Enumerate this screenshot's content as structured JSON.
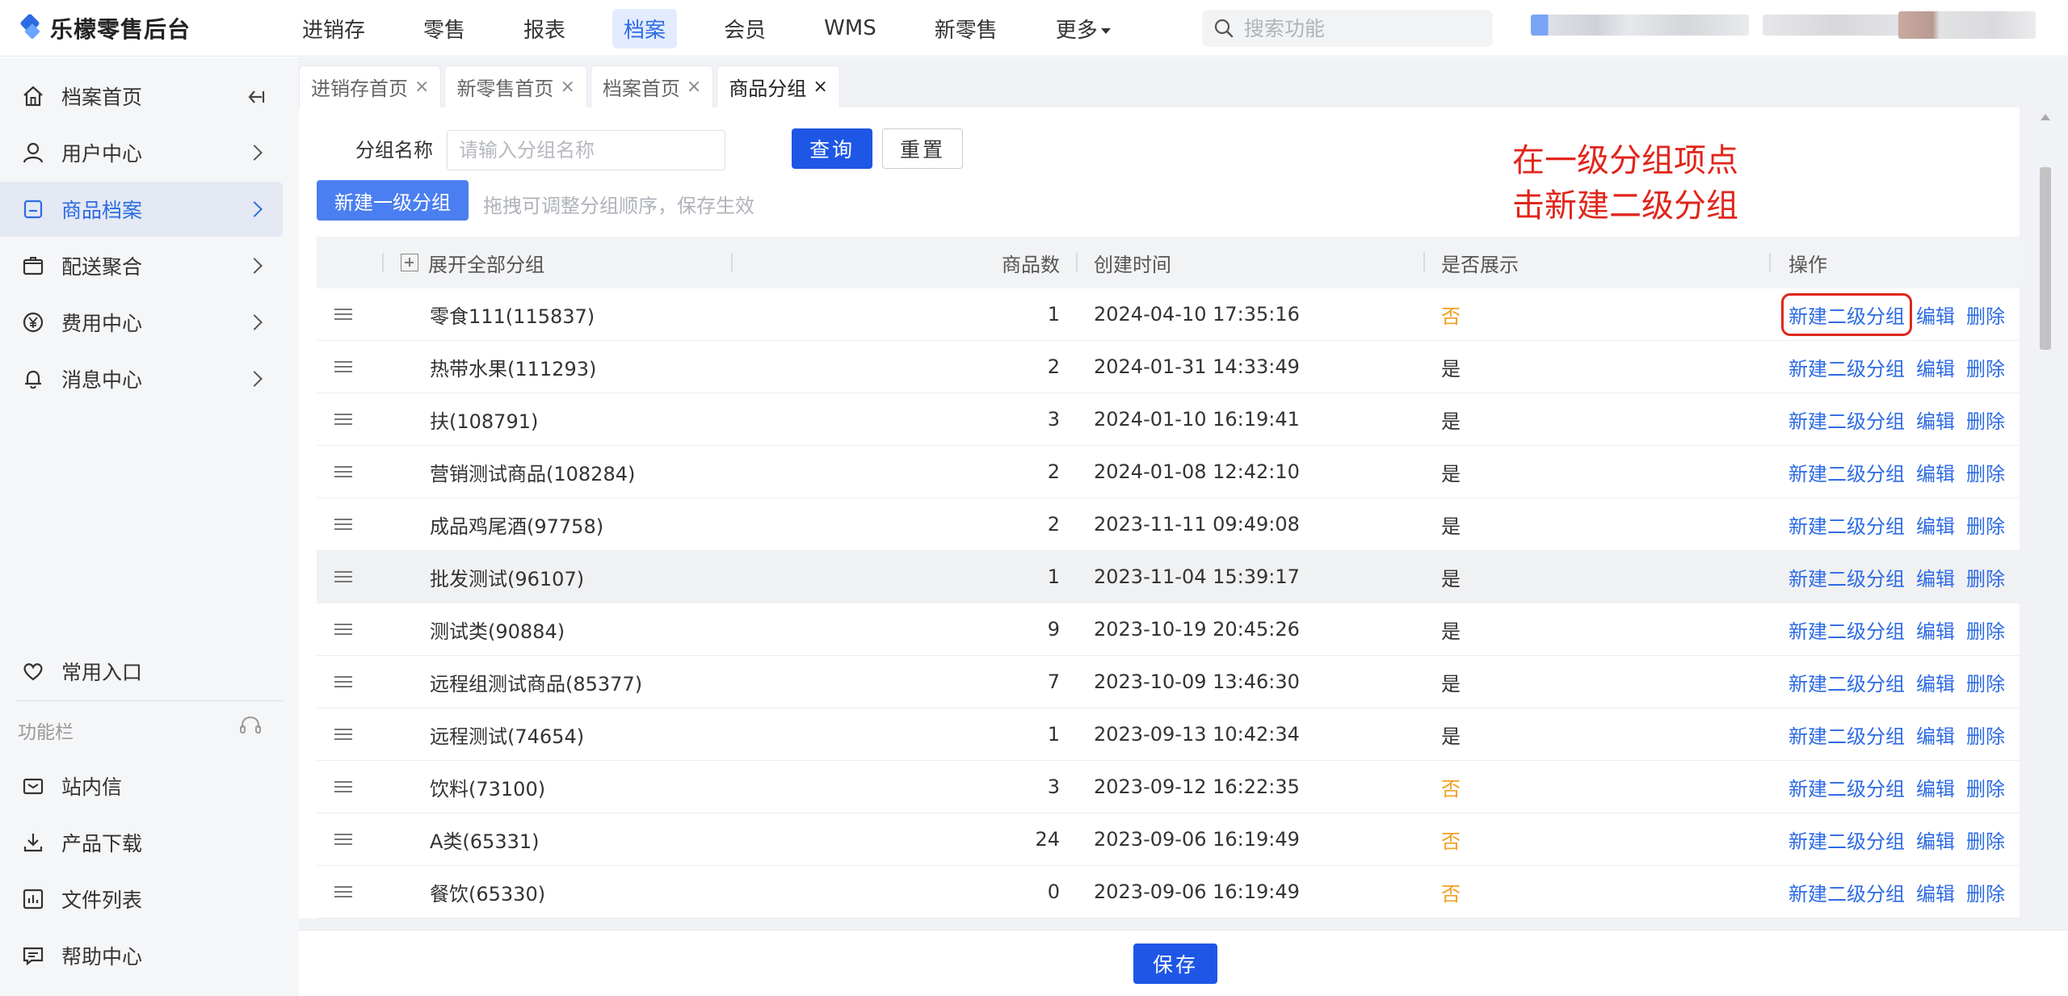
{
  "app": {
    "logo_text": "乐檬零售后台"
  },
  "topnav": {
    "items": [
      "进销存",
      "零售",
      "报表",
      "档案",
      "会员",
      "WMS",
      "新零售",
      "更多"
    ],
    "active": "档案",
    "search_placeholder": "搜索功能"
  },
  "sidebar": {
    "items": [
      {
        "label": "档案首页",
        "icon": "home-icon"
      },
      {
        "label": "用户中心",
        "icon": "user-icon"
      },
      {
        "label": "商品档案",
        "icon": "goods-icon"
      },
      {
        "label": "配送聚合",
        "icon": "delivery-icon"
      },
      {
        "label": "费用中心",
        "icon": "yen-icon"
      },
      {
        "label": "消息中心",
        "icon": "bell-icon"
      }
    ],
    "bottom_items": [
      {
        "label": "常用入口",
        "icon": "heart-icon"
      },
      {
        "label": "站内信",
        "icon": "mail-icon"
      },
      {
        "label": "产品下载",
        "icon": "download-icon"
      },
      {
        "label": "文件列表",
        "icon": "chart-icon"
      },
      {
        "label": "帮助中心",
        "icon": "chat-icon"
      }
    ],
    "section_label": "功能栏",
    "active": "商品档案"
  },
  "tabs": [
    {
      "label": "进销存首页",
      "close": "×"
    },
    {
      "label": "新零售首页",
      "close": "×"
    },
    {
      "label": "档案首页",
      "close": "×"
    },
    {
      "label": "商品分组",
      "close": "×"
    }
  ],
  "filter": {
    "label": "分组名称",
    "placeholder": "请输入分组名称",
    "search_btn": "查询",
    "reset_btn": "重置"
  },
  "actions": {
    "new_btn": "新建一级分组",
    "hint": "拖拽可调整分组顺序，保存生效",
    "save_btn": "保存"
  },
  "annotation": {
    "line1": "在一级分组项点",
    "line2": "击新建二级分组"
  },
  "table": {
    "headers": {
      "expand": "展开全部分组",
      "count": "商品数",
      "created": "创建时间",
      "show": "是否展示",
      "ops": "操作"
    },
    "op_labels": {
      "new_sub": "新建二级分组",
      "edit": "编辑",
      "delete": "删除"
    },
    "rows": [
      {
        "name": "零食111(115837)",
        "count": "1",
        "created": "2024-04-10 17:35:16",
        "show": "否"
      },
      {
        "name": "热带水果(111293)",
        "count": "2",
        "created": "2024-01-31 14:33:49",
        "show": "是"
      },
      {
        "name": "扶(108791)",
        "count": "3",
        "created": "2024-01-10 16:19:41",
        "show": "是"
      },
      {
        "name": "营销测试商品(108284)",
        "count": "2",
        "created": "2024-01-08 12:42:10",
        "show": "是"
      },
      {
        "name": "成品鸡尾酒(97758)",
        "count": "2",
        "created": "2023-11-11 09:49:08",
        "show": "是"
      },
      {
        "name": "批发测试(96107)",
        "count": "1",
        "created": "2023-11-04 15:39:17",
        "show": "是"
      },
      {
        "name": "测试类(90884)",
        "count": "9",
        "created": "2023-10-19 20:45:26",
        "show": "是"
      },
      {
        "name": "远程组测试商品(85377)",
        "count": "7",
        "created": "2023-10-09 13:46:30",
        "show": "是"
      },
      {
        "name": "远程测试(74654)",
        "count": "1",
        "created": "2023-09-13 10:42:34",
        "show": "是"
      },
      {
        "name": "饮料(73100)",
        "count": "3",
        "created": "2023-09-12 16:22:35",
        "show": "否"
      },
      {
        "name": "A类(65331)",
        "count": "24",
        "created": "2023-09-06 16:19:49",
        "show": "否"
      },
      {
        "name": "餐饮(65330)",
        "count": "0",
        "created": "2023-09-06 16:19:49",
        "show": "否"
      }
    ]
  },
  "colors": {
    "primary": "#1e56e6",
    "link": "#2d6be4",
    "no": "#f0a020",
    "annotation": "#e0261c"
  }
}
